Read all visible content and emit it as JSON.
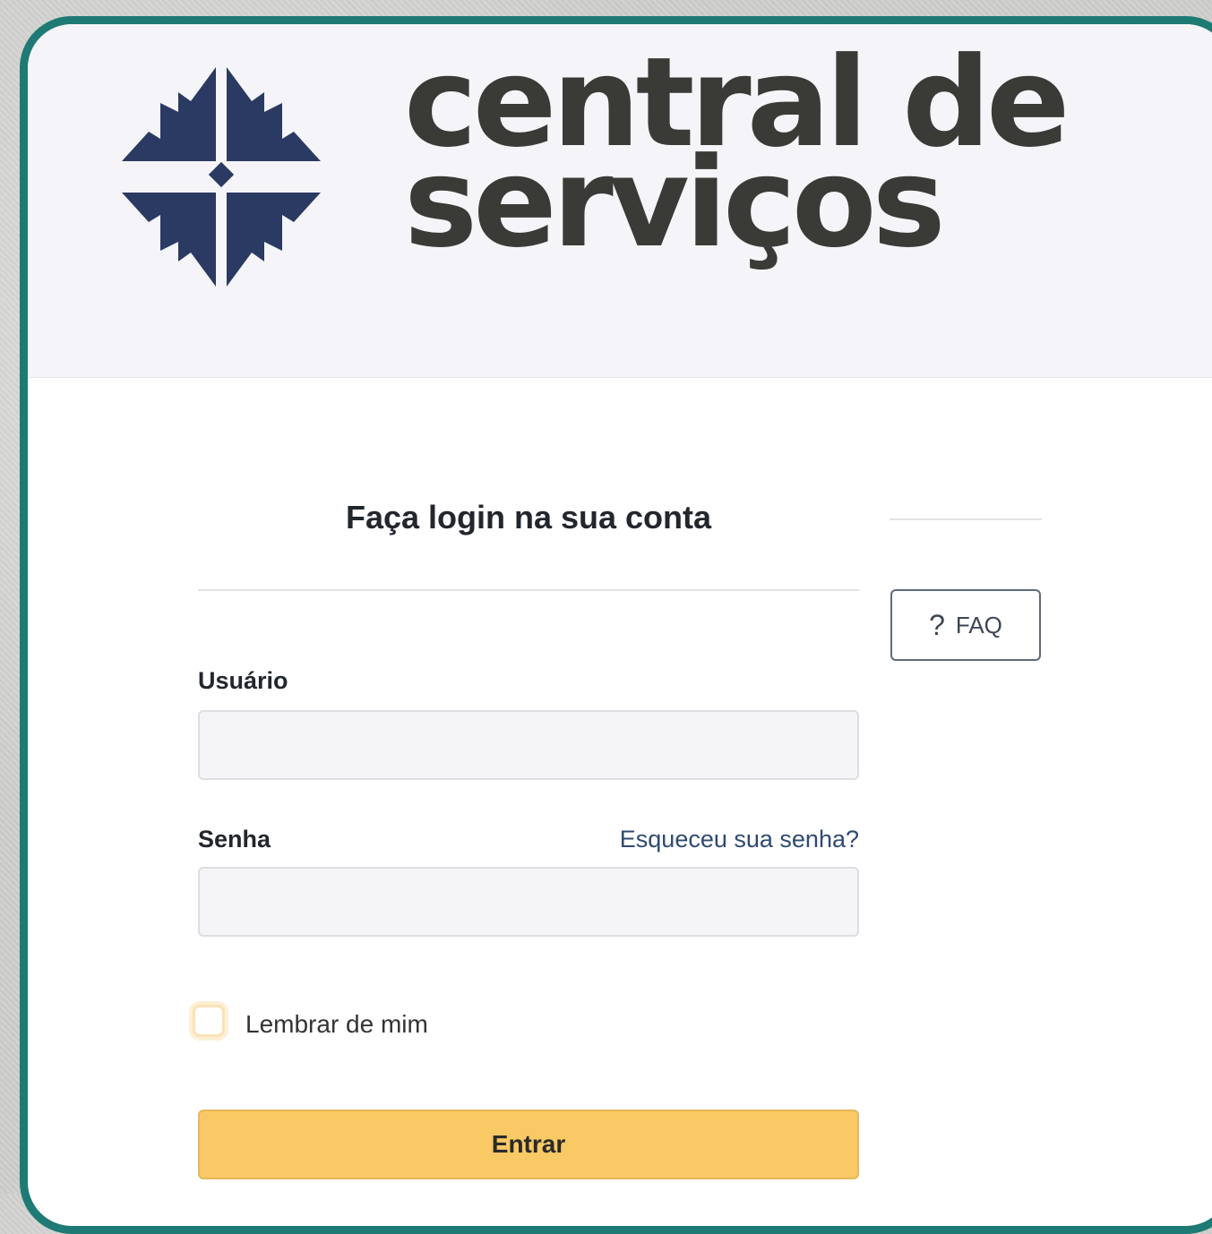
{
  "header": {
    "logo_line1": "central de",
    "logo_line2": "serviços",
    "logo_color": "#2b3a63",
    "logo_text_color": "#3a3a36"
  },
  "login": {
    "title": "Faça login na sua conta",
    "username_label": "Usuário",
    "username_value": "",
    "password_label": "Senha",
    "password_value": "",
    "forgot_password": "Esqueceu sua senha?",
    "remember_me": "Lembrar de mim",
    "remember_checked": false,
    "submit_label": "Entrar",
    "submit_color": "#f9c965"
  },
  "faq": {
    "icon": "question-icon",
    "icon_glyph": "?",
    "label": "FAQ"
  },
  "theme": {
    "frame_color": "#1e7a74",
    "header_bg": "#f5f5f9"
  }
}
